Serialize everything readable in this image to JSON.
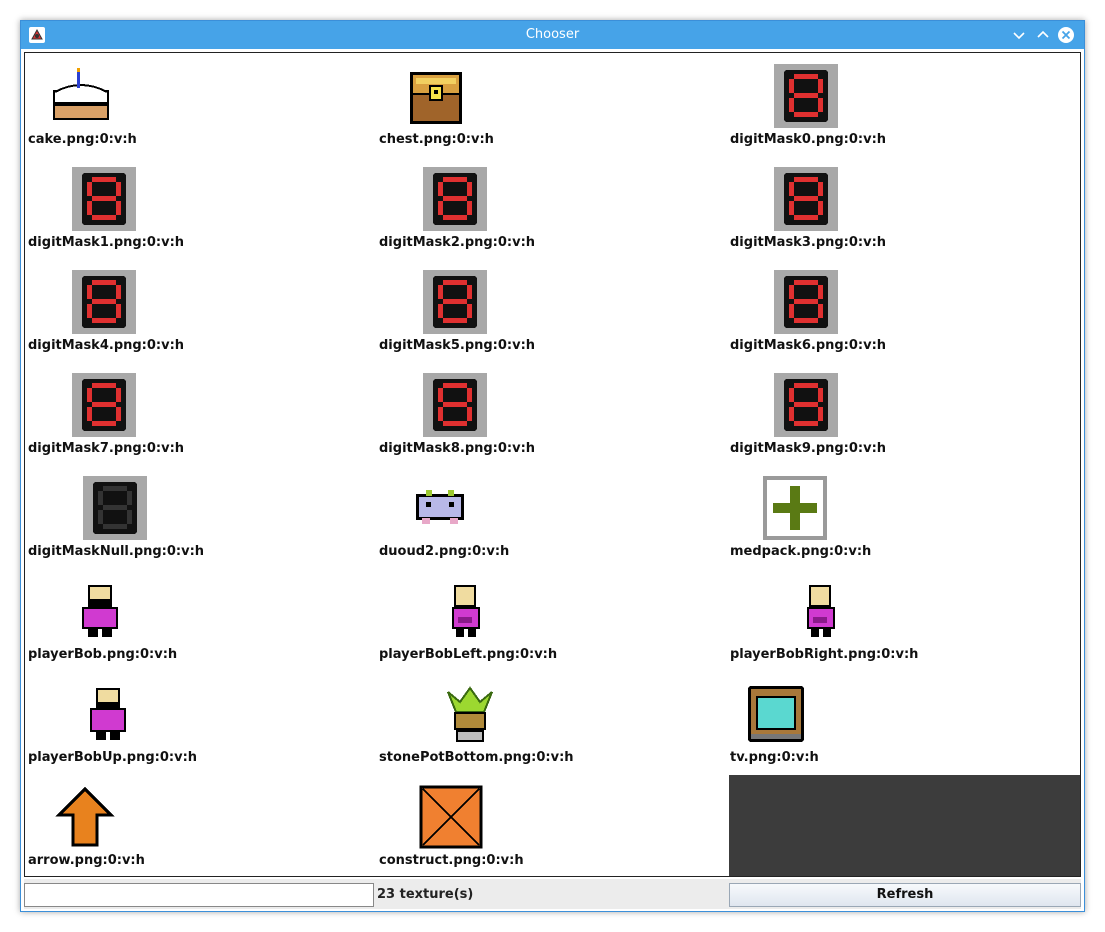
{
  "window": {
    "title": "Chooser",
    "app_icon": "java-duke-icon"
  },
  "titlebar_buttons": [
    {
      "name": "minimize",
      "icon": "chevron-down-icon"
    },
    {
      "name": "maximize",
      "icon": "chevron-up-icon"
    },
    {
      "name": "close",
      "icon": "close-icon"
    }
  ],
  "textures": [
    {
      "label": "cake.png:0:v:h",
      "icon": "cake"
    },
    {
      "label": "chest.png:0:v:h",
      "icon": "chest"
    },
    {
      "label": "digitMask0.png:0:v:h",
      "icon": "digit"
    },
    {
      "label": "digitMask1.png:0:v:h",
      "icon": "digit"
    },
    {
      "label": "digitMask2.png:0:v:h",
      "icon": "digit"
    },
    {
      "label": "digitMask3.png:0:v:h",
      "icon": "digit"
    },
    {
      "label": "digitMask4.png:0:v:h",
      "icon": "digit"
    },
    {
      "label": "digitMask5.png:0:v:h",
      "icon": "digit"
    },
    {
      "label": "digitMask6.png:0:v:h",
      "icon": "digit"
    },
    {
      "label": "digitMask7.png:0:v:h",
      "icon": "digit"
    },
    {
      "label": "digitMask8.png:0:v:h",
      "icon": "digit"
    },
    {
      "label": "digitMask9.png:0:v:h",
      "icon": "digit"
    },
    {
      "label": "digitMaskNull.png:0:v:h",
      "icon": "digitnull"
    },
    {
      "label": "duoud2.png:0:v:h",
      "icon": "duoud"
    },
    {
      "label": "medpack.png:0:v:h",
      "icon": "medpack"
    },
    {
      "label": "playerBob.png:0:v:h",
      "icon": "bob"
    },
    {
      "label": "playerBobLeft.png:0:v:h",
      "icon": "bobside"
    },
    {
      "label": "playerBobRight.png:0:v:h",
      "icon": "bobside"
    },
    {
      "label": "playerBobUp.png:0:v:h",
      "icon": "bobup"
    },
    {
      "label": "stonePotBottom.png:0:v:h",
      "icon": "pot"
    },
    {
      "label": "tv.png:0:v:h",
      "icon": "tv"
    },
    {
      "label": "arrow.png:0:v:h",
      "icon": "arrow"
    },
    {
      "label": "construct.png:0:v:h",
      "icon": "construct"
    }
  ],
  "bottom": {
    "filter_value": "",
    "count_text": "23 texture(s)",
    "refresh_label": "Refresh"
  }
}
